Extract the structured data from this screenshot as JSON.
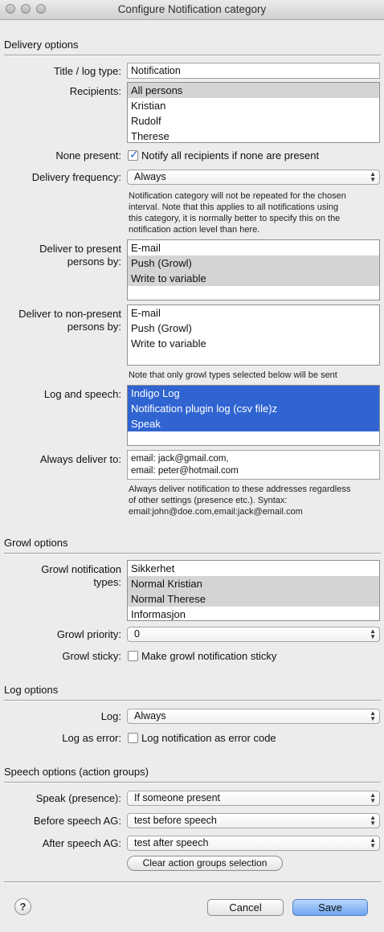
{
  "window": {
    "title": "Configure Notification category"
  },
  "delivery": {
    "section": "Delivery options",
    "title_label": "Title / log type:",
    "title_value": "Notification",
    "recipients_label": "Recipients:",
    "recipients": [
      "All persons",
      "Kristian",
      "Rudolf",
      "Therese"
    ],
    "none_present_label": "None present:",
    "none_present_checkbox": "Notify all recipients if none are present",
    "frequency_label": "Delivery frequency:",
    "frequency_value": "Always",
    "frequency_note": [
      "Notification category will not be repeated for the chosen",
      "interval. Note that this applies to all notifications using",
      "this category, it is normally better to specify this on the",
      "notification action level than here."
    ],
    "present_label": [
      "Deliver to present",
      "persons by:"
    ],
    "present_items": [
      "E-mail",
      "Push (Growl)",
      "Write to variable"
    ],
    "nonpresent_label": [
      "Deliver to non-present",
      "persons by:"
    ],
    "nonpresent_items": [
      "E-mail",
      "Push (Growl)",
      "Write to variable"
    ],
    "growl_note": "Note that only growl types selected below will be sent",
    "log_speech_label": "Log and speech:",
    "log_speech_items": [
      "Indigo Log",
      "Notification plugin log (csv file)z",
      "Speak"
    ],
    "always_label": "Always deliver to:",
    "always_value": [
      "email: jack@gmail.com,",
      "email: peter@hotmail.com"
    ],
    "always_note": [
      "Always deliver notification to these addresses regardless",
      "of other settings (presence etc.). Syntax:",
      "email:john@doe.com,email:jack@email.com"
    ]
  },
  "growl": {
    "section": "Growl options",
    "types_label": [
      "Growl notification",
      "types:"
    ],
    "types": [
      "Sikkerhet",
      "Normal Kristian",
      "Normal Therese",
      "Informasjon"
    ],
    "priority_label": "Growl priority:",
    "priority_value": "0",
    "sticky_label": "Growl sticky:",
    "sticky_checkbox": "Make growl notification sticky"
  },
  "log": {
    "section": "Log options",
    "log_label": "Log:",
    "log_value": "Always",
    "error_label": "Log as error:",
    "error_checkbox": "Log notification as error code"
  },
  "speech": {
    "section": "Speech options (action groups)",
    "speak_label": "Speak (presence):",
    "speak_value": "If someone present",
    "before_label": "Before speech AG:",
    "before_value": "test before speech",
    "after_label": "After speech AG:",
    "after_value": "test after speech",
    "clear_button": "Clear action groups selection"
  },
  "footer": {
    "help": "?",
    "cancel": "Cancel",
    "save": "Save"
  },
  "colors": {
    "selection_blue": "#2f64d1",
    "selection_gray": "#d4d4d4",
    "default_button": "#6fa6ef"
  }
}
